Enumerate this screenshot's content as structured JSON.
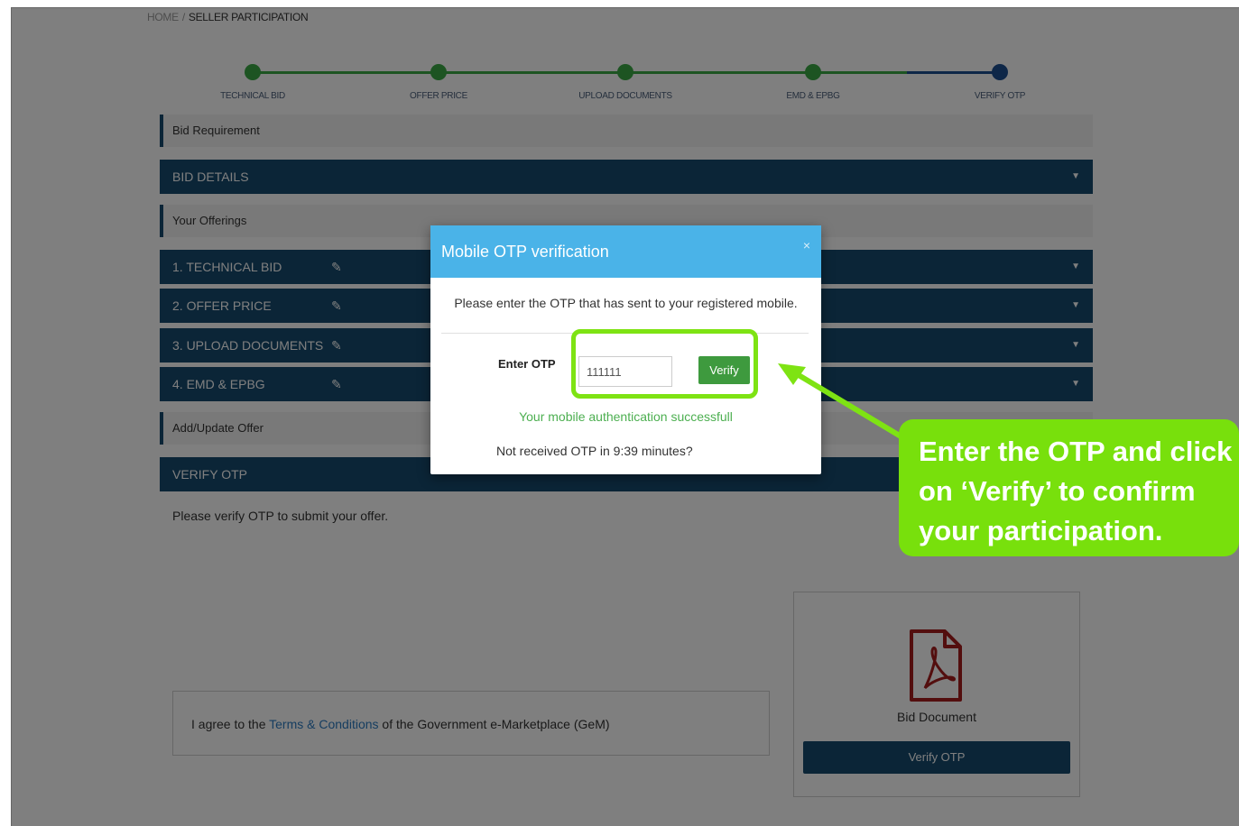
{
  "breadcrumb": {
    "home": "HOME",
    "sep": "/",
    "current": "SELLER PARTICIPATION"
  },
  "stepper": {
    "steps": [
      {
        "label": "TECHNICAL BID",
        "state": "done"
      },
      {
        "label": "OFFER PRICE",
        "state": "done"
      },
      {
        "label": "UPLOAD DOCUMENTS",
        "state": "done"
      },
      {
        "label": "EMD & EPBG",
        "state": "done"
      },
      {
        "label": "VERIFY OTP",
        "state": "current"
      }
    ]
  },
  "sections": {
    "bid_requirement": "Bid Requirement",
    "bid_details": "BID DETAILS",
    "your_offerings": "Your Offerings",
    "offerings": [
      {
        "label": "1. TECHNICAL BID"
      },
      {
        "label": "2. OFFER PRICE"
      },
      {
        "label": "3. UPLOAD DOCUMENTS"
      },
      {
        "label": "4. EMD & EPBG"
      }
    ],
    "add_update": "Add/Update Offer",
    "verify_otp": "VERIFY OTP"
  },
  "hint": "Please verify OTP to submit your offer.",
  "terms": {
    "prefix": "I agree to the ",
    "link": "Terms & Conditions",
    "suffix": " of the Government e-Marketplace (GeM)"
  },
  "doc_card": {
    "label": "Bid Document",
    "button": "Verify OTP"
  },
  "modal": {
    "title": "Mobile OTP verification",
    "close": "×",
    "message": "Please enter the OTP that has sent to your registered mobile.",
    "otp_label": "Enter OTP",
    "otp_value": "111111",
    "verify_label": "Verify",
    "success": "Your mobile authentication successfull",
    "not_received": "Not received OTP in 9:39 minutes?"
  },
  "callout": {
    "line1": "Enter the OTP and click",
    "line2": "on ‘Verify’ to confirm",
    "line3": "your participation."
  },
  "colors": {
    "accent_bar": "#174b6e",
    "step_done": "#3aa845",
    "step_current": "#1d4f91",
    "modal_header": "#4ab3e8",
    "callout": "#78e00c"
  },
  "icons": {
    "caret": "caret-down-icon",
    "edit": "edit-icon",
    "pdf": "pdf-document-icon"
  }
}
